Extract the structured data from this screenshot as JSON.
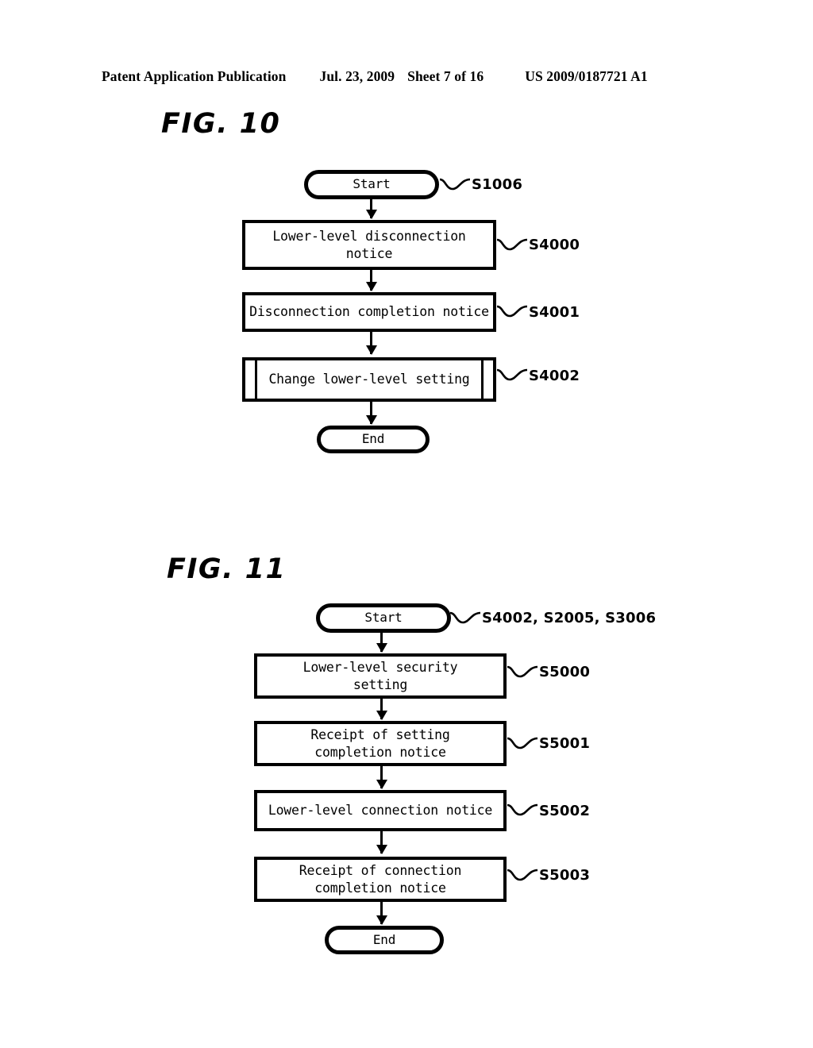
{
  "header": {
    "publication": "Patent Application Publication",
    "date": "Jul. 23, 2009",
    "sheet": "Sheet 7 of 16",
    "patent_number": "US 2009/0187721 A1"
  },
  "figures": [
    {
      "title": "FIG. 10",
      "nodes": [
        {
          "id": "fig10-start",
          "shape": "terminator",
          "label": "Start",
          "ref": "S1006"
        },
        {
          "id": "fig10-s4000",
          "shape": "process",
          "label": "Lower-level disconnection\nnotice",
          "ref": "S4000"
        },
        {
          "id": "fig10-s4001",
          "shape": "process",
          "label": "Disconnection completion notice",
          "ref": "S4001"
        },
        {
          "id": "fig10-s4002",
          "shape": "predefined",
          "label": "Change lower-level setting",
          "ref": "S4002"
        },
        {
          "id": "fig10-end",
          "shape": "terminator",
          "label": "End",
          "ref": ""
        }
      ]
    },
    {
      "title": "FIG. 11",
      "nodes": [
        {
          "id": "fig11-start",
          "shape": "terminator",
          "label": "Start",
          "ref": "S4002, S2005, S3006"
        },
        {
          "id": "fig11-s5000",
          "shape": "process",
          "label": "Lower-level security\nsetting",
          "ref": "S5000"
        },
        {
          "id": "fig11-s5001",
          "shape": "process",
          "label": "Receipt of setting\ncompletion notice",
          "ref": "S5001"
        },
        {
          "id": "fig11-s5002",
          "shape": "process",
          "label": "Lower-level connection notice",
          "ref": "S5002"
        },
        {
          "id": "fig11-s5003",
          "shape": "process",
          "label": "Receipt of connection\ncompletion notice",
          "ref": "S5003"
        },
        {
          "id": "fig11-end",
          "shape": "terminator",
          "label": "End",
          "ref": ""
        }
      ]
    }
  ],
  "colors": {
    "ink": "#000000",
    "paper": "#ffffff"
  }
}
